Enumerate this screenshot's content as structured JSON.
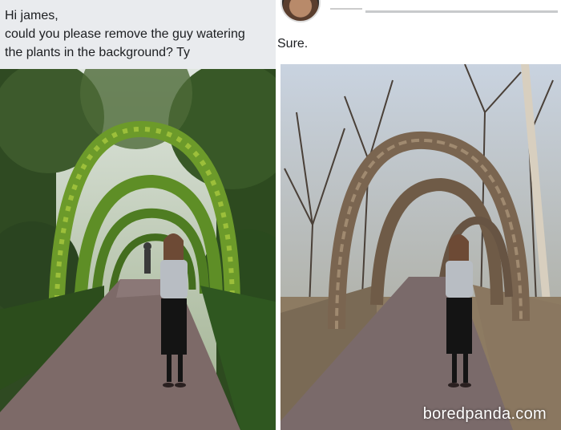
{
  "request": {
    "line1": "Hi james,",
    "line2": " could you please remove the guy watering",
    "line3": "the plants in the background? Ty"
  },
  "reply": {
    "text": "Sure."
  },
  "watermark": "boredpanda.com"
}
